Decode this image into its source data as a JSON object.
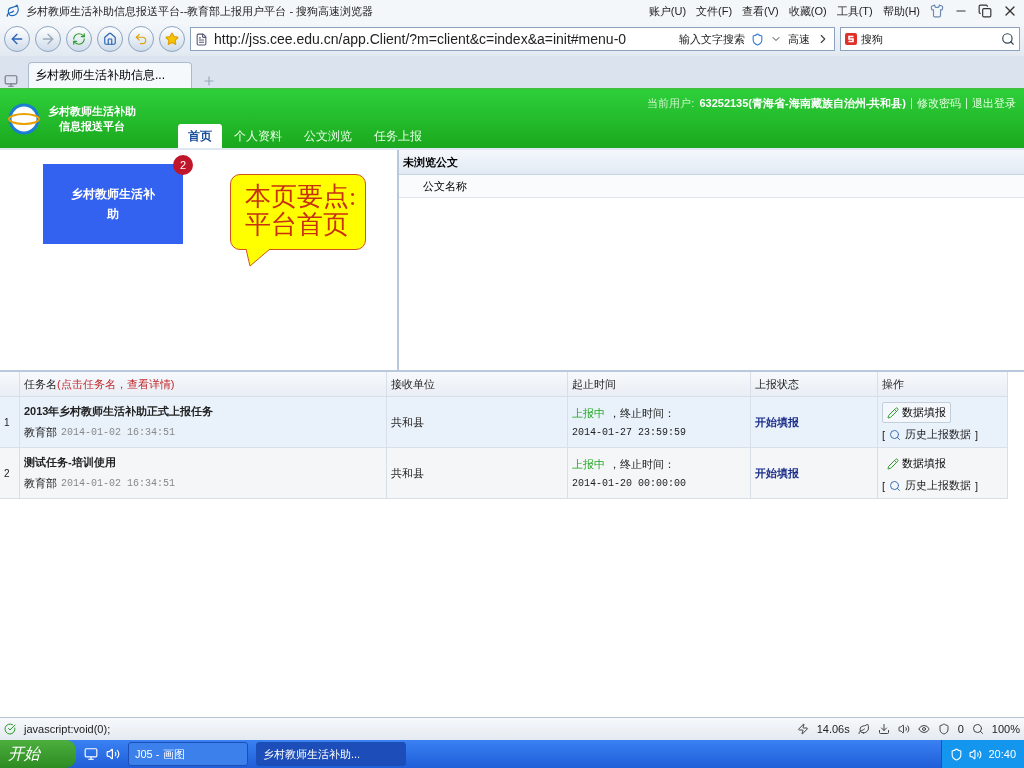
{
  "browser": {
    "title": "乡村教师生活补助信息报送平台--教育部上报用户平台 - 搜狗高速浏览器",
    "menu": [
      "账户(U)",
      "文件(F)",
      "查看(V)",
      "收藏(O)",
      "工具(T)",
      "帮助(H)"
    ],
    "url": "http://jss.cee.edu.cn/app.Client/?m=client&c=index&a=init#menu-0",
    "search_hint": "输入文字搜索",
    "speed": "高速",
    "search_engine": "搜狗",
    "tabs": [
      {
        "label": "乡村教师生活补助信息...",
        "selected": true
      }
    ],
    "status": "javascript:void(0);",
    "load_time": "14.06s",
    "shield_count": "0",
    "zoom": "100%"
  },
  "app": {
    "logo_lines": [
      "乡村教师生活补助",
      "信息报送平台"
    ],
    "nav": [
      {
        "label": "首页",
        "selected": true
      },
      {
        "label": "个人资料",
        "selected": false
      },
      {
        "label": "公文浏览",
        "selected": false
      },
      {
        "label": "任务上报",
        "selected": false
      }
    ],
    "user_label": "当前用户:",
    "user": "63252135(青海省-海南藏族自治州-共和县)",
    "links": [
      "修改密码",
      "退出登录"
    ]
  },
  "tile": {
    "label": "乡村教师生活补助",
    "badge": "2"
  },
  "callout": [
    "本页要点:",
    "平台首页"
  ],
  "docs": {
    "title": "未浏览公文",
    "column": "公文名称"
  },
  "tasks": {
    "columns": [
      {
        "title": "任务名",
        "hint": "(点击任务名，查看详情)"
      },
      {
        "title": "接收单位"
      },
      {
        "title": "起止时间"
      },
      {
        "title": "上报状态"
      },
      {
        "title": "操作"
      }
    ],
    "rows": [
      {
        "index": "1",
        "name": "2013年乡村教师生活补助正式上报任务",
        "org": "教育部",
        "date": "2014-01-02 16:34:51",
        "unit": "共和县",
        "status": "上报中",
        "end_label": "，终止时间：",
        "end": "2014-01-27 23:59:59",
        "state": "开始填报",
        "action": "数据填报",
        "history_open": "[",
        "history": "历史上报数据",
        "history_close": "]",
        "selected": true
      },
      {
        "index": "2",
        "name": "测试任务-培训使用",
        "org": "教育部",
        "date": "2014-01-02 16:34:51",
        "unit": "共和县",
        "status": "上报中",
        "end_label": "，终止时间：",
        "end": "2014-01-20 00:00:00",
        "state": "开始填报",
        "action": "数据填报",
        "history_open": "[",
        "history": "历史上报数据",
        "history_close": "]",
        "selected": false
      }
    ]
  },
  "taskbar": {
    "start": "开始",
    "windows": [
      {
        "label": "J05 - 画图",
        "selected": false
      },
      {
        "label": "乡村教师生活补助...",
        "selected": true
      }
    ],
    "clock": "20:40"
  }
}
